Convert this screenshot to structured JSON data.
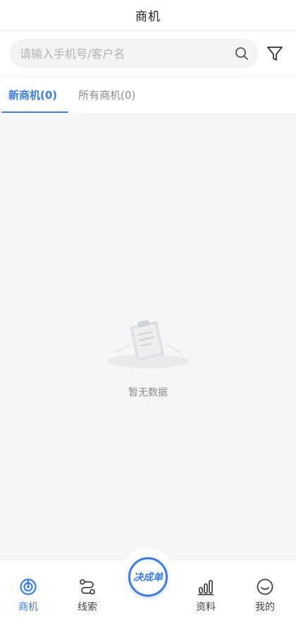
{
  "header": {
    "title": "商机"
  },
  "search": {
    "placeholder": "请输入手机号/客户名"
  },
  "tabs": [
    {
      "label": "新商机(0)",
      "active": true
    },
    {
      "label": "所有商机(0)",
      "active": false
    }
  ],
  "empty": {
    "text": "暂无数据"
  },
  "bottom_nav": {
    "items": [
      {
        "label": "商机",
        "icon": "target-icon",
        "active": true
      },
      {
        "label": "线索",
        "icon": "route-icon",
        "active": false
      },
      {
        "label": "资料",
        "icon": "bar-chart-icon",
        "active": false
      },
      {
        "label": "我的",
        "icon": "smile-icon",
        "active": false
      }
    ],
    "center_label": "决成单"
  },
  "colors": {
    "accent": "#3a7bf0",
    "background": "#f5f6f7"
  }
}
